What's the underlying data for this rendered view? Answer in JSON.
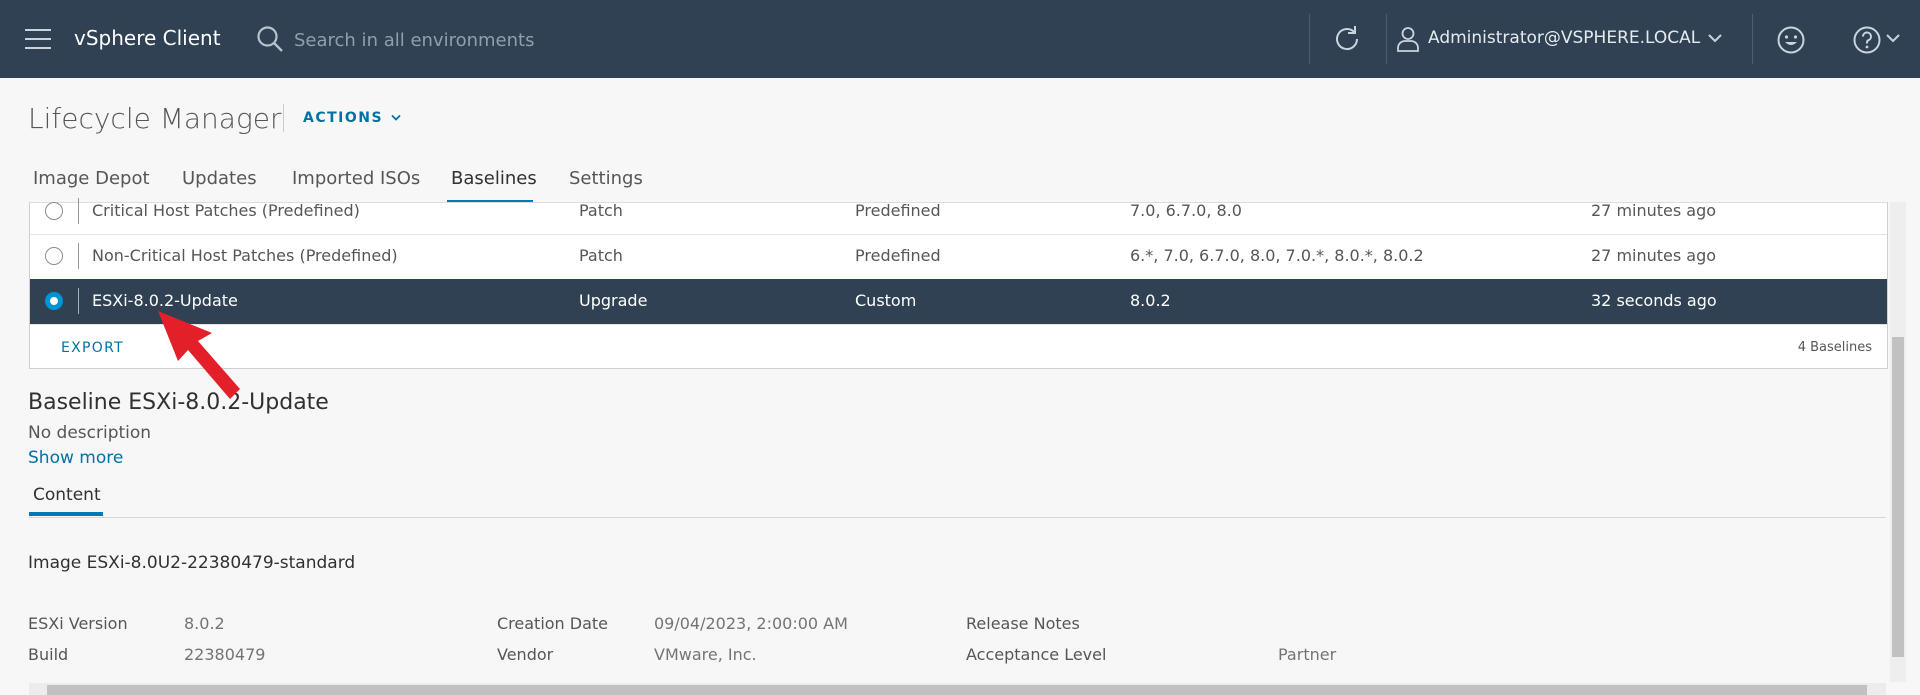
{
  "header": {
    "app_title": "vSphere Client",
    "search_placeholder": "Search in all environments",
    "user": "Administrator@VSPHERE.LOCAL",
    "bg_color": "#2f4153"
  },
  "page": {
    "title": "Lifecycle Manager",
    "actions_label": "ACTIONS"
  },
  "tabs": [
    {
      "label": "Image Depot"
    },
    {
      "label": "Updates"
    },
    {
      "label": "Imported ISOs"
    },
    {
      "label": "Baselines",
      "active": true
    },
    {
      "label": "Settings"
    }
  ],
  "baselines": {
    "rows": [
      {
        "name": "Critical Host Patches (Predefined)",
        "type": "Patch",
        "kind": "Predefined",
        "versions": "7.0, 6.7.0, 8.0",
        "modified": "27 minutes ago",
        "selected": false
      },
      {
        "name": "Non-Critical Host Patches (Predefined)",
        "type": "Patch",
        "kind": "Predefined",
        "versions": "6.*, 7.0, 6.7.0, 8.0, 7.0.*, 8.0.*, 8.0.2",
        "modified": "27 minutes ago",
        "selected": false
      },
      {
        "name": "ESXi-8.0.2-Update",
        "type": "Upgrade",
        "kind": "Custom",
        "versions": "8.0.2",
        "modified": "32 seconds ago",
        "selected": true
      }
    ],
    "export_label": "EXPORT",
    "count_label": "4 Baselines"
  },
  "details": {
    "title": "Baseline ESXi-8.0.2-Update",
    "description": "No description",
    "show_more": "Show more",
    "content_tab": "Content",
    "image_name": "Image ESXi-8.0U2-22380479-standard",
    "fields": {
      "esxi_version_label": "ESXi Version",
      "esxi_version": "8.0.2",
      "build_label": "Build",
      "build": "22380479",
      "creation_date_label": "Creation Date",
      "creation_date": "09/04/2023, 2:00:00 AM",
      "vendor_label": "Vendor",
      "vendor": "VMware, Inc.",
      "release_notes_label": "Release Notes",
      "acceptance_label": "Acceptance Level",
      "acceptance": "Partner"
    }
  },
  "colors": {
    "accent": "#0072a3",
    "selected_row": "#2f4153",
    "annotation_arrow": "#e3202a"
  }
}
